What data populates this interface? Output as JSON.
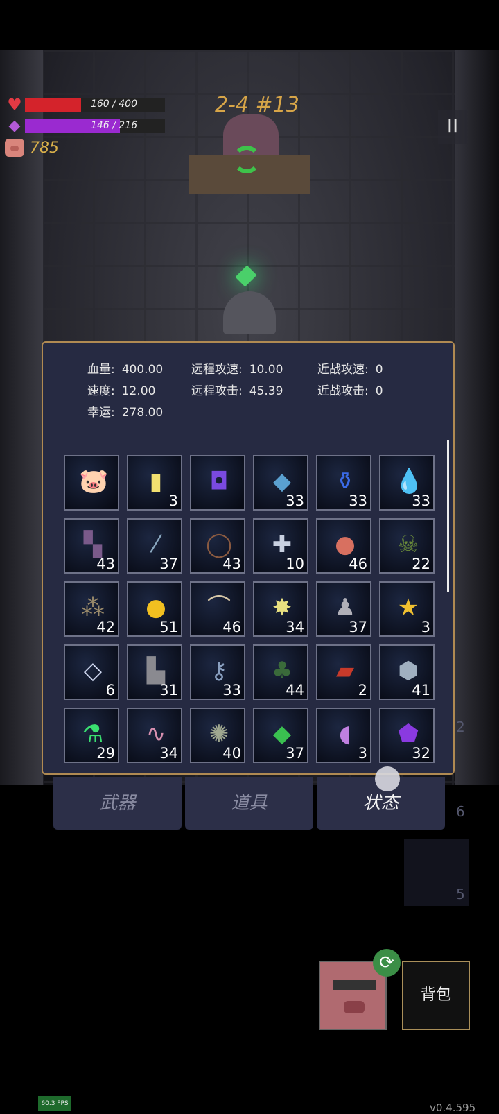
{
  "hud": {
    "hp_text": "160 / 400",
    "hp_fraction": 0.4,
    "hp_color": "#d4232b",
    "mana_text": "146 / 216",
    "mana_fraction": 0.676,
    "mana_color": "#9a2ad0",
    "coins": "785",
    "level": "2-4 #13",
    "pause_label": "II"
  },
  "stats": {
    "hp_label": "血量:",
    "hp_value": "400.00",
    "speed_label": "速度:",
    "speed_value": "12.00",
    "luck_label": "幸运:",
    "luck_value": "278.00",
    "ranged_speed_label": "远程攻速:",
    "ranged_speed_value": "10.00",
    "ranged_attack_label": "远程攻击:",
    "ranged_attack_value": "45.39",
    "melee_speed_label": "近战攻速:",
    "melee_speed_value": "0",
    "melee_attack_label": "近战攻击:",
    "melee_attack_value": "0"
  },
  "items": [
    {
      "icon": "piggy-bank",
      "glyph": "🐷",
      "count": "",
      "color": "#f0a0b0"
    },
    {
      "icon": "yellow-card",
      "glyph": "▮",
      "count": "3",
      "color": "#f2e070"
    },
    {
      "icon": "purple-rune",
      "glyph": "◘",
      "count": "",
      "color": "#7a4ae0"
    },
    {
      "icon": "blue-book",
      "glyph": "◆",
      "count": "33",
      "color": "#5aa0d0"
    },
    {
      "icon": "blue-potion",
      "glyph": "⚱",
      "count": "33",
      "color": "#3a6ae8"
    },
    {
      "icon": "water-drop",
      "glyph": "💧",
      "count": "33",
      "color": "#3a8ae0"
    },
    {
      "icon": "purple-boots",
      "glyph": "▚",
      "count": "43",
      "color": "#7a5a8a"
    },
    {
      "icon": "glass-vial",
      "glyph": "⁄",
      "count": "37",
      "color": "#8aa8c0"
    },
    {
      "icon": "thorn-crown",
      "glyph": "◯",
      "count": "43",
      "color": "#8a5a40"
    },
    {
      "icon": "medkit",
      "glyph": "✚",
      "count": "10",
      "color": "#c8d0e0"
    },
    {
      "icon": "apple",
      "glyph": "●",
      "count": "46",
      "color": "#d87060"
    },
    {
      "icon": "skull-book",
      "glyph": "☠",
      "count": "22",
      "color": "#6a8a3a"
    },
    {
      "icon": "rocks",
      "glyph": "⁂",
      "count": "42",
      "color": "#9a8a6a"
    },
    {
      "icon": "gold-coin",
      "glyph": "●",
      "count": "51",
      "color": "#f2c020"
    },
    {
      "icon": "horn",
      "glyph": "⌒",
      "count": "46",
      "color": "#d8c8a8"
    },
    {
      "icon": "star-bomb",
      "glyph": "✸",
      "count": "34",
      "color": "#e8e080"
    },
    {
      "icon": "ghost-statue",
      "glyph": "♟",
      "count": "37",
      "color": "#b0b0b8"
    },
    {
      "icon": "star-trophy",
      "glyph": "★",
      "count": "3",
      "color": "#f0c030"
    },
    {
      "icon": "silver-gem",
      "glyph": "◇",
      "count": "6",
      "color": "#d0d8f0"
    },
    {
      "icon": "tombstone",
      "glyph": "▙",
      "count": "31",
      "color": "#8a8a90"
    },
    {
      "icon": "key",
      "glyph": "⚷",
      "count": "33",
      "color": "#8aa0c0"
    },
    {
      "icon": "clover",
      "glyph": "♣",
      "count": "44",
      "color": "#3a6a3a"
    },
    {
      "icon": "red-book",
      "glyph": "▰",
      "count": "2",
      "color": "#c83a2a"
    },
    {
      "icon": "stone",
      "glyph": "⬢",
      "count": "41",
      "color": "#a0b0c0"
    },
    {
      "icon": "green-flask",
      "glyph": "⚗",
      "count": "29",
      "color": "#3ae070"
    },
    {
      "icon": "worm",
      "glyph": "∿",
      "count": "34",
      "color": "#d890b0"
    },
    {
      "icon": "octopus",
      "glyph": "✺",
      "count": "40",
      "color": "#a0a890"
    },
    {
      "icon": "green-crystal",
      "glyph": "◆",
      "count": "37",
      "color": "#3ac050"
    },
    {
      "icon": "purple-slime",
      "glyph": "◖",
      "count": "3",
      "color": "#c080e0"
    },
    {
      "icon": "purple-crystal",
      "glyph": "⬟",
      "count": "32",
      "color": "#8a3ae0"
    }
  ],
  "tabs": {
    "weapons": "武器",
    "items": "道具",
    "status": "状态"
  },
  "bag_label": "背包",
  "refresh_glyph": "⟳",
  "side_counts": {
    "a": "2",
    "b": "6",
    "c": "5"
  },
  "fps": "60.3 FPS",
  "version": "v0.4.595"
}
